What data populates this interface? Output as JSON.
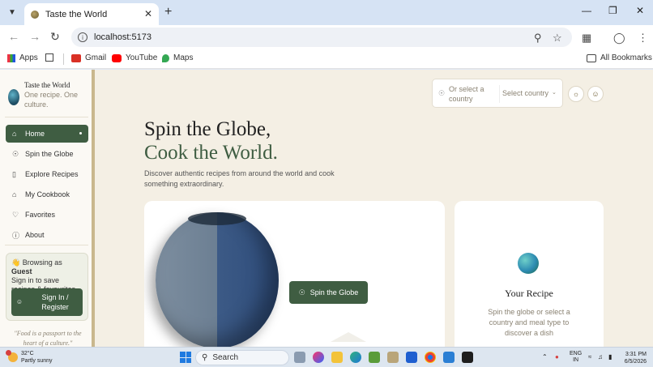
{
  "browser": {
    "tab_title": "Taste the World",
    "url": "localhost:5173",
    "bookmarks": [
      "Apps",
      "Gmail",
      "YouTube",
      "Maps"
    ],
    "all_bookmarks": "All Bookmarks",
    "icons": {
      "tab_menu": "chevron-down-icon",
      "close": "close-icon",
      "new_tab": "plus-icon",
      "zoom": "magnifier-icon",
      "star": "star-icon",
      "extensions": "puzzle-icon",
      "profile": "profile-icon",
      "menu": "kebab-icon"
    }
  },
  "app": {
    "brand_title": "Taste the World",
    "brand_tagline": "One recipe. One culture.",
    "nav": [
      {
        "label": "Home",
        "icon": "home-icon",
        "active": true
      },
      {
        "label": "Spin the Globe",
        "icon": "globe-icon",
        "active": false
      },
      {
        "label": "Explore Recipes",
        "icon": "book-icon",
        "active": false
      },
      {
        "label": "My Cookbook",
        "icon": "chef-hat-icon",
        "active": false
      },
      {
        "label": "Favorites",
        "icon": "heart-icon",
        "active": false
      },
      {
        "label": "About",
        "icon": "info-icon",
        "active": false
      }
    ],
    "guest": {
      "browsing_as": "Browsing as",
      "guest_label": "Guest",
      "message": "Sign in to save recipes & favourites",
      "signin_label": "Sign In / Register"
    },
    "quote": "\"Food is a passport to the heart of a culture.\"",
    "country_hint": "Or select a country",
    "country_select": "Select country",
    "hero_line1": "Spin the Globe,",
    "hero_line2": "Cook the World.",
    "hero_desc": "Discover authentic recipes from around the world and cook something extraordinary.",
    "spin_button": "Spin the Globe",
    "recipe_title": "Your Recipe",
    "recipe_desc": "Spin the globe or select a country and meal type to discover a dish",
    "colors": {
      "primary": "#3f5d42",
      "background": "#f4efe4",
      "muted": "#8a8272"
    }
  },
  "taskbar": {
    "temperature": "32°C",
    "weather": "Partly sunny",
    "search": "Search",
    "lang1": "ENG",
    "lang2": "IN",
    "time": "3:31 PM",
    "date": "6/5/2026"
  }
}
